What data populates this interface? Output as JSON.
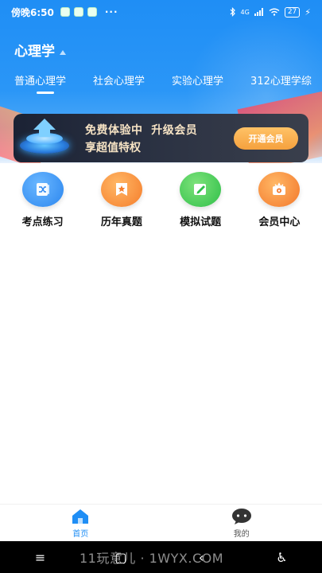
{
  "status_bar": {
    "time": "傍晚6:50",
    "dots": "···",
    "network": "4G",
    "battery": "27"
  },
  "header": {
    "title": "心理学"
  },
  "tabs": [
    {
      "label": "普通心理学"
    },
    {
      "label": "社会心理学"
    },
    {
      "label": "实验心理学"
    },
    {
      "label": "312心理学综"
    }
  ],
  "promo": {
    "line1": "免费体验中  升级会员",
    "line2": "享超值特权",
    "button_label": "开通会员"
  },
  "features": [
    {
      "label": "考点练习",
      "icon": "shuffle-book-icon"
    },
    {
      "label": "历年真题",
      "icon": "star-page-icon"
    },
    {
      "label": "模拟试题",
      "icon": "pencil-pad-icon"
    },
    {
      "label": "会员中心",
      "icon": "crown-icon"
    }
  ],
  "bottom_nav": {
    "home_label": "首页",
    "mine_label": "我的"
  },
  "watermark": "11玩意儿 · 1WYX.COM",
  "colors": {
    "accent": "#1f8ef5",
    "promo_button": "#f5a13e"
  }
}
